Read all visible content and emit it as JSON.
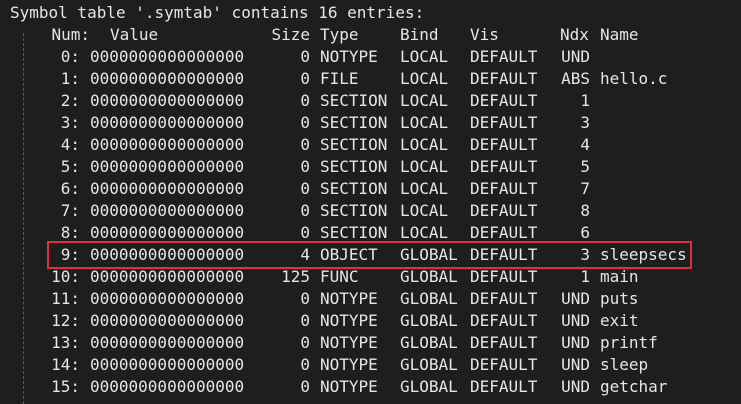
{
  "header": "Symbol table '.symtab' contains 16 entries:",
  "columns": {
    "num": "Num:",
    "value": "Value",
    "size": "Size",
    "type": "Type",
    "bind": "Bind",
    "vis": "Vis",
    "ndx": "Ndx",
    "name": "Name"
  },
  "rows": [
    {
      "num": "0:",
      "value": "0000000000000000",
      "size": "0",
      "type": "NOTYPE",
      "bind": "LOCAL",
      "vis": "DEFAULT",
      "ndx": "UND",
      "name": ""
    },
    {
      "num": "1:",
      "value": "0000000000000000",
      "size": "0",
      "type": "FILE",
      "bind": "LOCAL",
      "vis": "DEFAULT",
      "ndx": "ABS",
      "name": "hello.c"
    },
    {
      "num": "2:",
      "value": "0000000000000000",
      "size": "0",
      "type": "SECTION",
      "bind": "LOCAL",
      "vis": "DEFAULT",
      "ndx": "1",
      "name": ""
    },
    {
      "num": "3:",
      "value": "0000000000000000",
      "size": "0",
      "type": "SECTION",
      "bind": "LOCAL",
      "vis": "DEFAULT",
      "ndx": "3",
      "name": ""
    },
    {
      "num": "4:",
      "value": "0000000000000000",
      "size": "0",
      "type": "SECTION",
      "bind": "LOCAL",
      "vis": "DEFAULT",
      "ndx": "4",
      "name": ""
    },
    {
      "num": "5:",
      "value": "0000000000000000",
      "size": "0",
      "type": "SECTION",
      "bind": "LOCAL",
      "vis": "DEFAULT",
      "ndx": "5",
      "name": ""
    },
    {
      "num": "6:",
      "value": "0000000000000000",
      "size": "0",
      "type": "SECTION",
      "bind": "LOCAL",
      "vis": "DEFAULT",
      "ndx": "7",
      "name": ""
    },
    {
      "num": "7:",
      "value": "0000000000000000",
      "size": "0",
      "type": "SECTION",
      "bind": "LOCAL",
      "vis": "DEFAULT",
      "ndx": "8",
      "name": ""
    },
    {
      "num": "8:",
      "value": "0000000000000000",
      "size": "0",
      "type": "SECTION",
      "bind": "LOCAL",
      "vis": "DEFAULT",
      "ndx": "6",
      "name": ""
    },
    {
      "num": "9:",
      "value": "0000000000000000",
      "size": "4",
      "type": "OBJECT",
      "bind": "GLOBAL",
      "vis": "DEFAULT",
      "ndx": "3",
      "name": "sleepsecs"
    },
    {
      "num": "10:",
      "value": "0000000000000000",
      "size": "125",
      "type": "FUNC",
      "bind": "GLOBAL",
      "vis": "DEFAULT",
      "ndx": "1",
      "name": "main"
    },
    {
      "num": "11:",
      "value": "0000000000000000",
      "size": "0",
      "type": "NOTYPE",
      "bind": "GLOBAL",
      "vis": "DEFAULT",
      "ndx": "UND",
      "name": "puts"
    },
    {
      "num": "12:",
      "value": "0000000000000000",
      "size": "0",
      "type": "NOTYPE",
      "bind": "GLOBAL",
      "vis": "DEFAULT",
      "ndx": "UND",
      "name": "exit"
    },
    {
      "num": "13:",
      "value": "0000000000000000",
      "size": "0",
      "type": "NOTYPE",
      "bind": "GLOBAL",
      "vis": "DEFAULT",
      "ndx": "UND",
      "name": "printf"
    },
    {
      "num": "14:",
      "value": "0000000000000000",
      "size": "0",
      "type": "NOTYPE",
      "bind": "GLOBAL",
      "vis": "DEFAULT",
      "ndx": "UND",
      "name": "sleep"
    },
    {
      "num": "15:",
      "value": "0000000000000000",
      "size": "0",
      "type": "NOTYPE",
      "bind": "GLOBAL",
      "vis": "DEFAULT",
      "ndx": "UND",
      "name": "getchar"
    }
  ],
  "highlight_color": "#e0303a",
  "background_color": "#1e1e1e"
}
